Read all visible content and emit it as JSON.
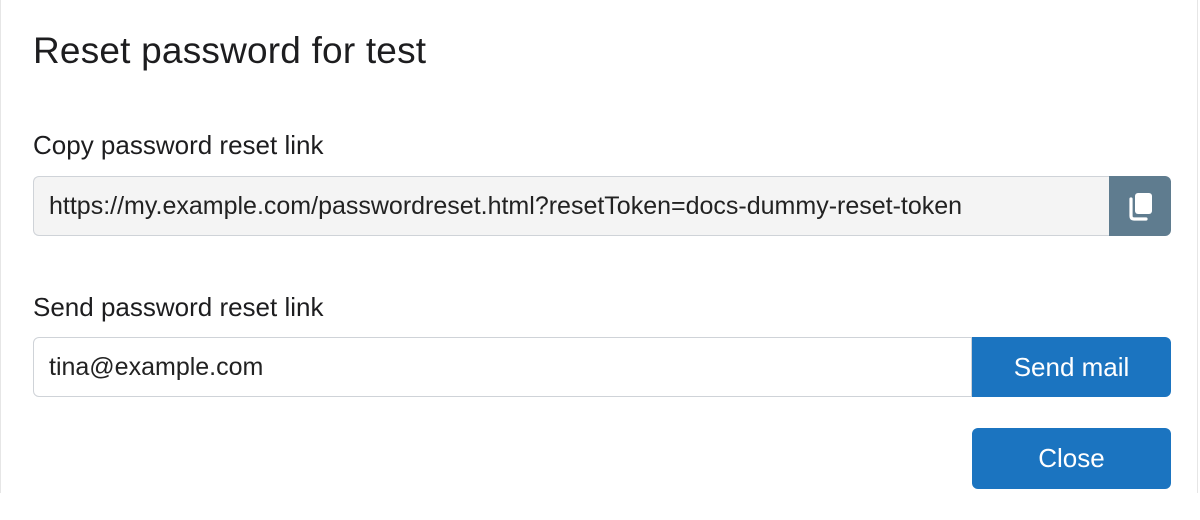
{
  "dialog": {
    "title": "Reset password for test"
  },
  "copy_section": {
    "label": "Copy password reset link",
    "link_value": "https://my.example.com/passwordreset.html?resetToken=docs-dummy-reset-token",
    "copy_icon": "copy-icon"
  },
  "send_section": {
    "label": "Send password reset link",
    "email_value": "tina@example.com",
    "send_label": "Send mail"
  },
  "footer": {
    "close_label": "Close"
  },
  "colors": {
    "primary": "#1b74c0",
    "copy_button": "#5f7c8f",
    "readonly_field_bg": "#f4f4f4"
  }
}
